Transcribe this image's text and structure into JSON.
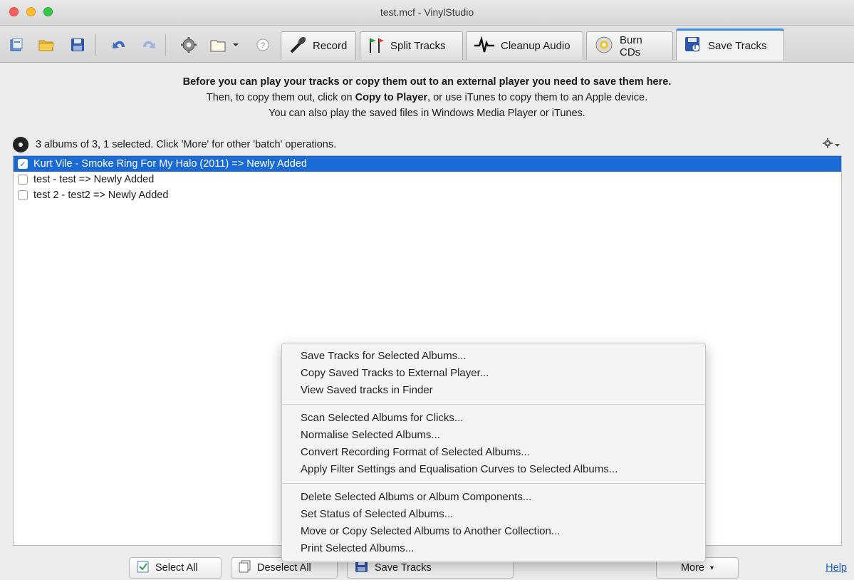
{
  "window": {
    "title": "test.mcf - VinylStudio"
  },
  "toolbar": {
    "tabs": [
      {
        "label": "Record",
        "icon": "microphone-icon",
        "active": false
      },
      {
        "label": "Split Tracks",
        "icon": "split-flags-icon",
        "active": false
      },
      {
        "label": "Cleanup Audio",
        "icon": "waveform-icon",
        "active": false
      },
      {
        "label": "Burn CDs",
        "icon": "cd-icon",
        "active": false
      },
      {
        "label": "Save Tracks",
        "icon": "save-tracks-icon",
        "active": true
      }
    ],
    "help_glyph": "?"
  },
  "intro": {
    "line1": "Before you can play your tracks or copy them out to an external player you need to save them here.",
    "line2_prefix": "Then, to copy them out, click on ",
    "line2_bold": "Copy to Player",
    "line2_suffix": ", or use iTunes to copy them to an Apple device.",
    "line3": "You can also play the saved files in Windows Media Player or iTunes."
  },
  "status": {
    "text": "3 albums of 3, 1 selected.  Click 'More' for other 'batch' operations."
  },
  "albums": [
    {
      "label": "Kurt Vile - Smoke Ring For My Halo (2011) => Newly Added",
      "checked": true,
      "selected": true
    },
    {
      "label": "test - test => Newly Added",
      "checked": false,
      "selected": false
    },
    {
      "label": "test 2 - test2 => Newly Added",
      "checked": false,
      "selected": false
    }
  ],
  "buttons": {
    "select_all": "Select All",
    "deselect_all": "Deselect All",
    "save_tracks": "Save Tracks",
    "more": "More",
    "help": "Help"
  },
  "menu": {
    "groups": [
      [
        "Save Tracks for Selected Albums...",
        "Copy Saved Tracks to External Player...",
        "View Saved tracks in Finder"
      ],
      [
        "Scan Selected Albums for Clicks...",
        "Normalise Selected Albums...",
        "Convert Recording Format of Selected Albums...",
        "Apply Filter Settings and Equalisation Curves to Selected Albums..."
      ],
      [
        "Delete Selected Albums or Album Components...",
        "Set Status of Selected Albums...",
        "Move or Copy Selected Albums to Another Collection...",
        "Print Selected Albums..."
      ]
    ]
  },
  "colors": {
    "accent": "#1a6ad6",
    "tab_active_border": "#3f8ee6",
    "link": "#1a5fd0"
  }
}
